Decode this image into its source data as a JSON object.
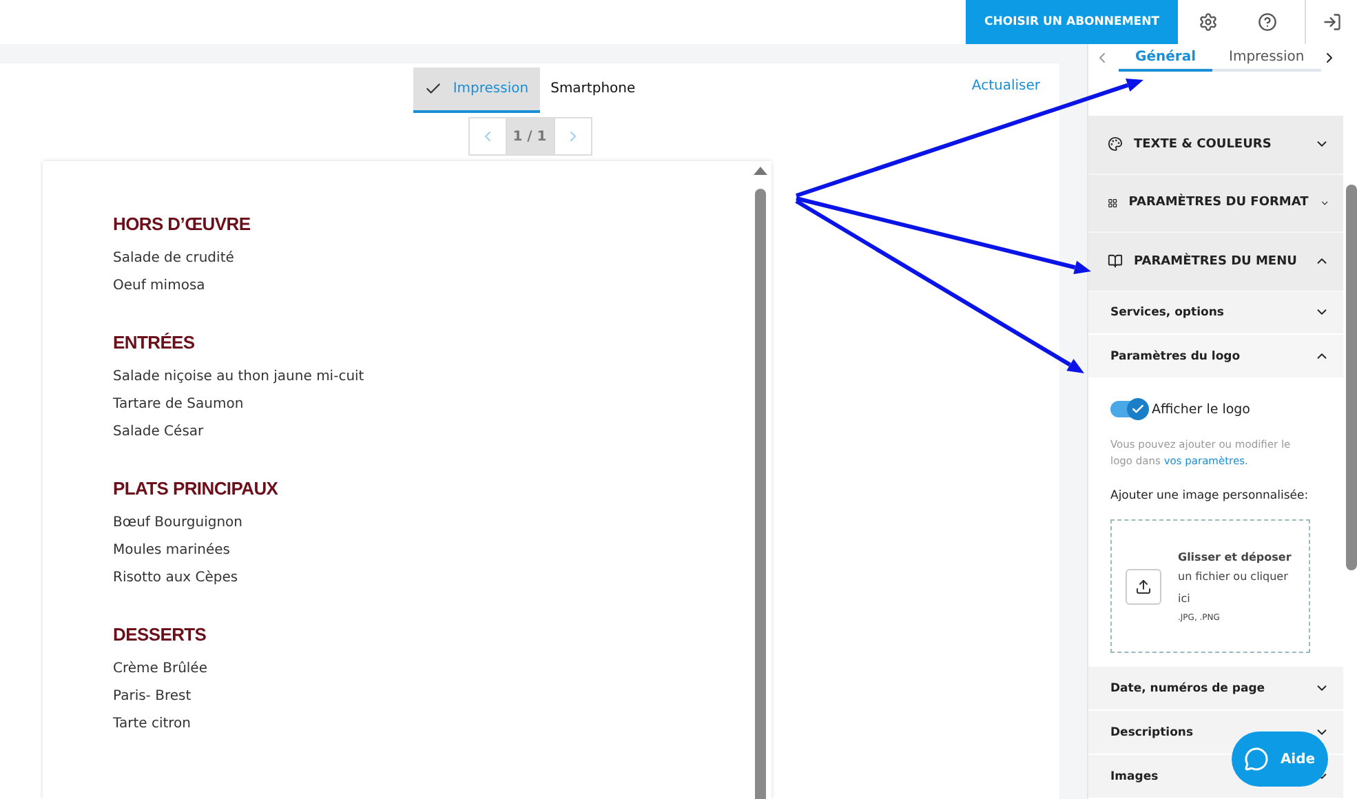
{
  "topbar": {
    "subscribe_button": "CHOISIR UN ABONNEMENT"
  },
  "preview": {
    "view_tabs": [
      {
        "label": "Impression",
        "selected": true
      },
      {
        "label": "Smartphone",
        "selected": false
      }
    ],
    "refresh_link": "Actualiser",
    "pager": {
      "page": "1 / 1"
    },
    "menu": [
      {
        "heading": "HORS D’ŒUVRE",
        "items": [
          "Salade de crudité",
          "Oeuf mimosa"
        ]
      },
      {
        "heading": "ENTRÉES",
        "items": [
          "Salade niçoise au thon jaune mi-cuit",
          "Tartare de Saumon",
          "Salade César"
        ]
      },
      {
        "heading": "PLATS PRINCIPAUX",
        "items": [
          "Bœuf Bourguignon",
          "Moules marinées",
          "Risotto aux Cèpes"
        ]
      },
      {
        "heading": "DESSERTS",
        "items": [
          "Crème Brûlée",
          "Paris- Brest",
          "Tarte citron"
        ]
      }
    ]
  },
  "sidebar": {
    "tabs": [
      {
        "label": "Général",
        "selected": true
      },
      {
        "label": "Impression",
        "selected": false
      }
    ],
    "sections": [
      {
        "title": "TEXTE & COULEURS",
        "expanded": false
      },
      {
        "title": "PARAMÈTRES DU FORMAT",
        "expanded": false
      },
      {
        "title": "PARAMÈTRES DU MENU",
        "expanded": true,
        "children": [
          {
            "title": "Services, options",
            "expanded": false
          },
          {
            "title": "Paramètres du logo",
            "expanded": true
          },
          {
            "title": "Date, numéros de page",
            "expanded": false
          },
          {
            "title": "Descriptions",
            "expanded": false
          },
          {
            "title": "Images",
            "expanded": false
          }
        ]
      }
    ],
    "logo_settings": {
      "toggle": {
        "label": "Afficher le logo",
        "on": true
      },
      "hint": "Vous pouvez ajouter ou modifier le logo dans",
      "hint_link": "vos paramètres.",
      "upload_label": "Ajouter une image personnalisée:",
      "drop_title": "Glisser et déposer",
      "drop_text": "un fichier ou cliquer ici",
      "formats": ".JPG, .PNG"
    }
  },
  "help_button": "Aide"
}
